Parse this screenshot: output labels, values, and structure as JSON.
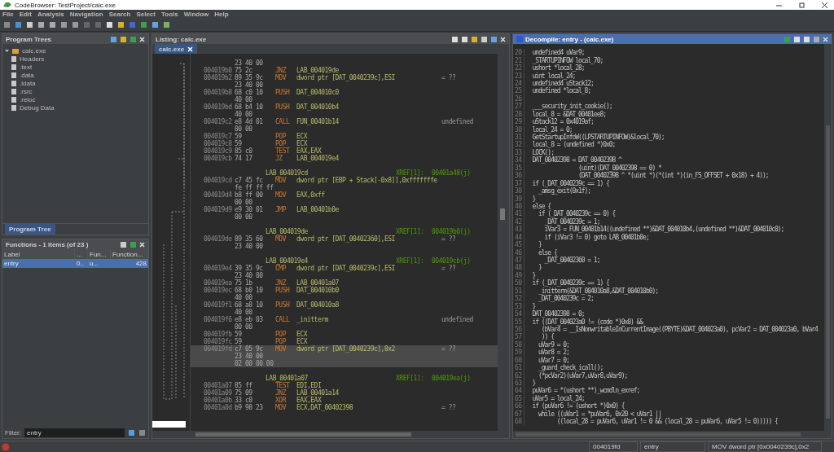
{
  "window": {
    "title": "CodeBrowser: TestProject/calc.exe"
  },
  "menu": [
    "File",
    "Edit",
    "Analysis",
    "Navigation",
    "Search",
    "Select",
    "Tools",
    "Window",
    "Help"
  ],
  "program_trees": {
    "title": "Program Trees",
    "tree": [
      {
        "label": "calc.exe",
        "expanded": true,
        "children": [
          {
            "label": "Headers"
          },
          {
            "label": ".text"
          },
          {
            "label": ".data"
          },
          {
            "label": ".idata"
          },
          {
            "label": ".rsrc"
          },
          {
            "label": ".reloc"
          },
          {
            "label": "Debug Data"
          }
        ]
      }
    ],
    "tab": "Program Tree"
  },
  "functions": {
    "title": "Functions - 1 items (of 23 )",
    "columns": [
      "Label",
      "...",
      "Fun...",
      "Function..."
    ],
    "rows": [
      {
        "cells": [
          "entry",
          "0..",
          "u...",
          "428"
        ],
        "selected": true
      }
    ],
    "filter_label": "Filter:",
    "filter_value": "entry"
  },
  "listing": {
    "title": "Listing: calc.exe",
    "tab": "calc.exe",
    "rows": [
      {
        "kind": "cont",
        "bytes": "23 40 00",
        "selected": false
      },
      {
        "kind": "instr",
        "address": "004019b0",
        "bytes": "75 2c",
        "mnemonic": "JNZ",
        "operand": "LAB_004019de",
        "selected": false
      },
      {
        "kind": "instr",
        "address": "004019b2",
        "bytes": "89 35 9c",
        "mnemonic": "MOV",
        "operand": "dword ptr [DAT_0040239c],ESI",
        "comment": "= ??",
        "selected": false
      },
      {
        "kind": "cont",
        "bytes": "23 40 00",
        "selected": false
      },
      {
        "kind": "instr",
        "address": "004019b8",
        "bytes": "68 c0 10",
        "mnemonic": "PUSH",
        "operand": "DAT_004010c0",
        "selected": false
      },
      {
        "kind": "cont",
        "bytes": "40 00",
        "selected": false
      },
      {
        "kind": "instr",
        "address": "004019bd",
        "bytes": "68 b4 10",
        "mnemonic": "PUSH",
        "operand": "DAT_004010b4",
        "selected": false
      },
      {
        "kind": "cont",
        "bytes": "40 00",
        "selected": false
      },
      {
        "kind": "instr",
        "address": "004019c2",
        "bytes": "e8 4d 01",
        "mnemonic": "CALL",
        "operand": "FUN_00401b14",
        "comment": "undefined",
        "selected": false
      },
      {
        "kind": "cont",
        "bytes": "00 00",
        "selected": false
      },
      {
        "kind": "instr",
        "address": "004019c7",
        "bytes": "59",
        "mnemonic": "POP",
        "operand": "ECX",
        "selected": false
      },
      {
        "kind": "instr",
        "address": "004019c8",
        "bytes": "59",
        "mnemonic": "POP",
        "operand": "ECX",
        "selected": false
      },
      {
        "kind": "instr",
        "address": "004019c9",
        "bytes": "85 c0",
        "mnemonic": "TEST",
        "operand": "EAX,EAX",
        "selected": false
      },
      {
        "kind": "instr",
        "address": "004019cb",
        "bytes": "74 17",
        "mnemonic": "JZ",
        "operand": "LAB_004019e4",
        "selected": false
      },
      {
        "kind": "blank",
        "selected": false
      },
      {
        "kind": "label",
        "label": "LAB_004019cd",
        "xref": "XREF[1]:",
        "refs": "00401a48(j)",
        "selected": false
      },
      {
        "kind": "instr",
        "address": "004019cd",
        "bytes": "c7 45 fc",
        "mnemonic": "MOV",
        "operand": "dword ptr [EBP + Stack[-0x8]],0xfffffffe",
        "selected": false
      },
      {
        "kind": "cont",
        "bytes": "fe ff ff ff",
        "selected": false
      },
      {
        "kind": "instr",
        "address": "004019d4",
        "bytes": "b8 ff 00",
        "mnemonic": "MOV",
        "operand": "EAX,0xff",
        "selected": false
      },
      {
        "kind": "cont",
        "bytes": "00 00",
        "selected": false
      },
      {
        "kind": "instr",
        "address": "004019d9",
        "bytes": "e9 30 01",
        "mnemonic": "JMP",
        "operand": "LAB_00401b0e",
        "selected": false
      },
      {
        "kind": "cont",
        "bytes": "00 00",
        "selected": false
      },
      {
        "kind": "blank",
        "selected": false
      },
      {
        "kind": "label",
        "label": "LAB_004019de",
        "xref": "XREF[1]:",
        "refs": "004019b0(j)",
        "selected": false
      },
      {
        "kind": "instr",
        "address": "004019de",
        "bytes": "89 35 60",
        "mnemonic": "MOV",
        "operand": "dword ptr [DAT_00402360],ESI",
        "comment": "= ??",
        "selected": false
      },
      {
        "kind": "cont",
        "bytes": "23 40 00",
        "selected": false
      },
      {
        "kind": "blank",
        "selected": false
      },
      {
        "kind": "label",
        "label": "LAB_004019e4",
        "xref": "XREF[1]:",
        "refs": "004019cb(j)",
        "selected": false
      },
      {
        "kind": "instr",
        "address": "004019e4",
        "bytes": "39 35 9c",
        "mnemonic": "CMP",
        "operand": "dword ptr [DAT_0040239c],ESI",
        "comment": "= ??",
        "selected": false
      },
      {
        "kind": "cont",
        "bytes": "23 40 00",
        "selected": false
      },
      {
        "kind": "instr",
        "address": "004019ea",
        "bytes": "75 1b",
        "mnemonic": "JNZ",
        "operand": "LAB_00401a07",
        "selected": false
      },
      {
        "kind": "instr",
        "address": "004019ec",
        "bytes": "68 b0 10",
        "mnemonic": "PUSH",
        "operand": "DAT_004010b0",
        "selected": false
      },
      {
        "kind": "cont",
        "bytes": "40 00",
        "selected": false
      },
      {
        "kind": "instr",
        "address": "004019f1",
        "bytes": "68 a8 10",
        "mnemonic": "PUSH",
        "operand": "DAT_004010a8",
        "selected": false
      },
      {
        "kind": "cont",
        "bytes": "40 00",
        "selected": false
      },
      {
        "kind": "instr",
        "address": "004019f6",
        "bytes": "e8 eb 03",
        "mnemonic": "CALL",
        "operand": "_initterm",
        "comment": "undefined",
        "selected": false
      },
      {
        "kind": "cont",
        "bytes": "00 00",
        "selected": false
      },
      {
        "kind": "instr",
        "address": "004019fb",
        "bytes": "59",
        "mnemonic": "POP",
        "operand": "ECX",
        "selected": false
      },
      {
        "kind": "instr",
        "address": "004019fc",
        "bytes": "59",
        "mnemonic": "POP",
        "operand": "ECX",
        "selected": false
      },
      {
        "kind": "instr",
        "address": "004019fd",
        "bytes": "c7 05 9c",
        "mnemonic": "MOV",
        "operand": "dword ptr [DAT_0040239c],0x2",
        "comment": "= ??",
        "selected": true
      },
      {
        "kind": "cont",
        "bytes": "23 40 00",
        "selected": true
      },
      {
        "kind": "cont",
        "bytes": "02 00 00 00",
        "selected": true
      },
      {
        "kind": "blank",
        "selected": false
      },
      {
        "kind": "label",
        "label": "LAB_00401a07",
        "xref": "XREF[1]:",
        "refs": "004019ea(j)",
        "selected": false
      },
      {
        "kind": "instr",
        "address": "00401a07",
        "bytes": "85 ff",
        "mnemonic": "TEST",
        "operand": "EDI,EDI",
        "selected": false
      },
      {
        "kind": "instr",
        "address": "00401a09",
        "bytes": "75 09",
        "mnemonic": "JNZ",
        "operand": "LAB_00401a14",
        "selected": false
      },
      {
        "kind": "instr",
        "address": "00401a0b",
        "bytes": "33 c0",
        "mnemonic": "XOR",
        "operand": "EAX,EAX",
        "selected": false
      },
      {
        "kind": "instr",
        "address": "00401a0d",
        "bytes": "b9 98 23",
        "mnemonic": "MOV",
        "operand": "ECX,DAT_00402398",
        "comment": "= ??",
        "selected": false
      }
    ]
  },
  "decompile": {
    "title": "Decompile: entry - (calc.exe)",
    "lines": [
      {
        "n": "20",
        "code": "  undefined4 uVar9;"
      },
      {
        "n": "21",
        "code": "  _STARTUPINFOW local_70;"
      },
      {
        "n": "22",
        "code": "  ushort *local_28;"
      },
      {
        "n": "23",
        "code": "  uint local_24;"
      },
      {
        "n": "24",
        "code": "  undefined4 uStack12;"
      },
      {
        "n": "25",
        "code": "  undefined *local_8;"
      },
      {
        "n": "26"
      },
      {
        "n": "27",
        "code": "  ___security_init_cookie();"
      },
      {
        "n": "28",
        "code": "  local_8 = &DAT_00401ee8;"
      },
      {
        "n": "29",
        "code": "  uStack12 = 0x4019af;"
      },
      {
        "n": "30",
        "code": "  local_24 = 0;"
      },
      {
        "n": "31",
        "code": "  GetStartupInfoW((LPSTARTUPINFOW)&local_70);"
      },
      {
        "n": "32",
        "code": "  local_8 = (undefined *)0x0;"
      },
      {
        "n": "33",
        "code": "  LOCK();"
      },
      {
        "n": "34",
        "code": "  DAT_00402398 = DAT_00402398 ^"
      },
      {
        "n": "35",
        "code": "                 (uint)(DAT_00402398 == 0) *"
      },
      {
        "n": "36",
        "code": "                 (DAT_00402398 ^ *(uint *)(*(int *)(in_FS_OFFSET + 0x18) + 4));"
      },
      {
        "n": "37",
        "code": "  if (_DAT_0040239c == 1) {"
      },
      {
        "n": "38",
        "code": "    _amsg_exit(0x1f);"
      },
      {
        "n": "39",
        "code": "  }"
      },
      {
        "n": "40",
        "code": "  else {"
      },
      {
        "n": "41",
        "code": "    if (_DAT_0040239c == 0) {"
      },
      {
        "n": "42",
        "code": "      _DAT_0040239c = 1;"
      },
      {
        "n": "43",
        "code": "      iVar3 = FUN_00401b14((undefined **)&DAT_004010b4,(undefined **)&DAT_004010c0);"
      },
      {
        "n": "44",
        "code": "      if (iVar3 != 0) goto LAB_00401b0e;"
      },
      {
        "n": "45",
        "code": "    }"
      },
      {
        "n": "46",
        "code": "    else {"
      },
      {
        "n": "47",
        "code": "      _DAT_00402360 = 1;"
      },
      {
        "n": "48",
        "code": "    }"
      },
      {
        "n": "49",
        "code": "  }"
      },
      {
        "n": "50",
        "code": "  if (_DAT_0040239c == 1) {"
      },
      {
        "n": "51",
        "code": "    _initterm(&DAT_004010a8,&DAT_004010b0);"
      },
      {
        "n": "52",
        "code": "    _DAT_0040239c = 2;"
      },
      {
        "n": "53",
        "code": "  }"
      },
      {
        "n": "54",
        "code": "  DAT_00402398 = 0;"
      },
      {
        "n": "55",
        "code": "  if ((DAT_004023a0 != (code *)0x0) &&"
      },
      {
        "n": "56",
        "code": "     (bVar4 = __IsNonwritableInCurrentImage((PBYTE)&DAT_004023a0), pcVar2 = DAT_004023a0, bVar4"
      },
      {
        "n": "57",
        "code": "     )) {"
      },
      {
        "n": "58",
        "code": "    uVar9 = 0;"
      },
      {
        "n": "59",
        "code": "    uVar8 = 2;"
      },
      {
        "n": "60",
        "code": "    uVar7 = 0;"
      },
      {
        "n": "61",
        "code": "    _guard_check_icall();"
      },
      {
        "n": "62",
        "code": "    (*pcVar2)(uVar7,uVar8,uVar9);"
      },
      {
        "n": "63",
        "code": "  }"
      },
      {
        "n": "64",
        "code": "  puVar6 = *(ushort **)_wcmdln_exref;"
      },
      {
        "n": "65",
        "code": "  uVar5 = local_24;"
      },
      {
        "n": "66",
        "code": "  if (puVar6 != (ushort *)0x0) {"
      },
      {
        "n": "67",
        "code": "    while ((uVar1 = *puVar6, 0x20 < uVar1 ||"
      },
      {
        "n": "68",
        "code": "          ((local_28 = puVar6, uVar1 != 0 && (local_28 = puVar6, uVar5 != 0))))) {"
      }
    ]
  },
  "status_bar": [
    "004019fd",
    "entry",
    "MOV dword ptr [0x0040239c],0x2"
  ]
}
